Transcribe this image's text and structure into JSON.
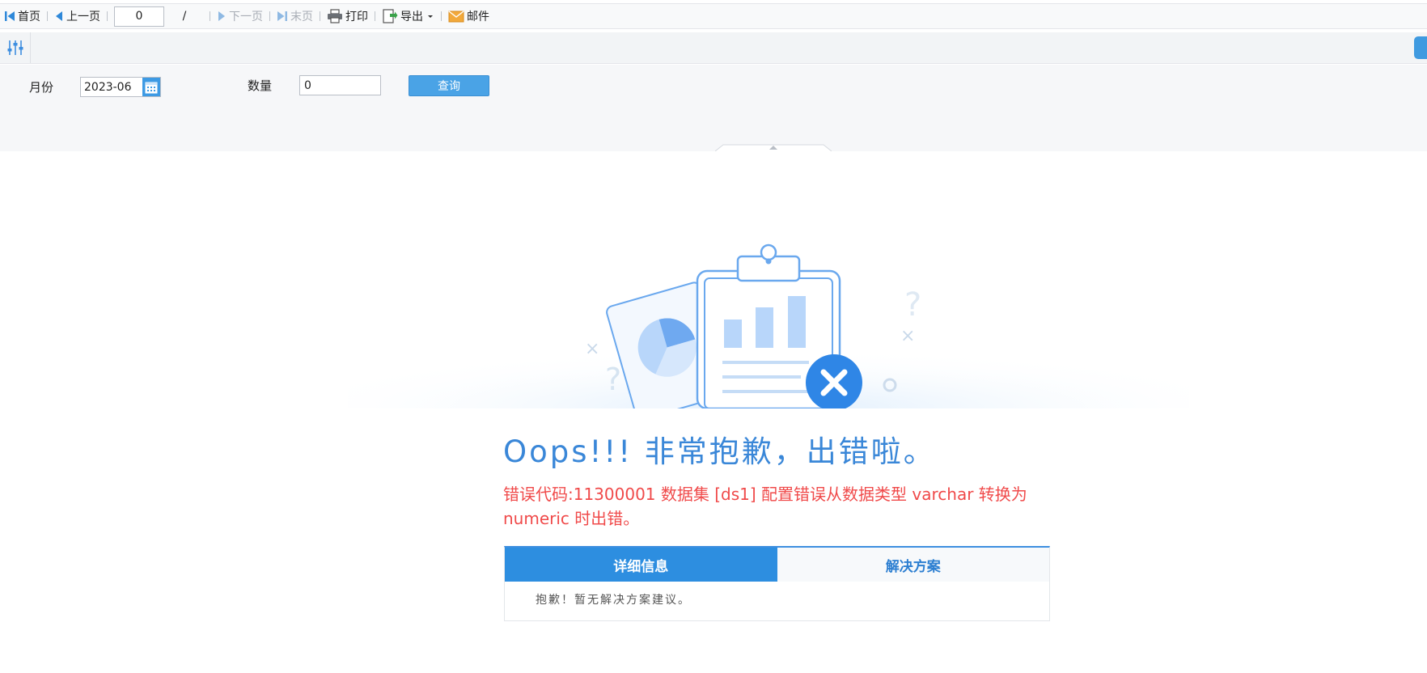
{
  "toolbar": {
    "first_label": "首页",
    "prev_label": "上一页",
    "page_value": "0",
    "page_slash": "/",
    "next_label": "下一页",
    "last_label": "末页",
    "print_label": "打印",
    "export_label": "导出",
    "mail_label": "邮件"
  },
  "params": {
    "month_label": "月份",
    "month_value": "2023-06",
    "qty_label": "数量",
    "qty_value": "0",
    "query_label": "查询"
  },
  "error": {
    "title": "Oops!!! 非常抱歉，出错啦。",
    "message": "错误代码:11300001 数据集 [ds1] 配置错误从数据类型 varchar 转换为 numeric 时出错。",
    "tabs": [
      {
        "label": "详细信息",
        "active": true
      },
      {
        "label": "解决方案",
        "active": false
      }
    ],
    "panel_text": "抱歉！暂无解决方案建议。"
  },
  "colors": {
    "accent": "#2d8ee0",
    "error_text": "#f04a4a",
    "title_blue": "#3a87d8"
  }
}
